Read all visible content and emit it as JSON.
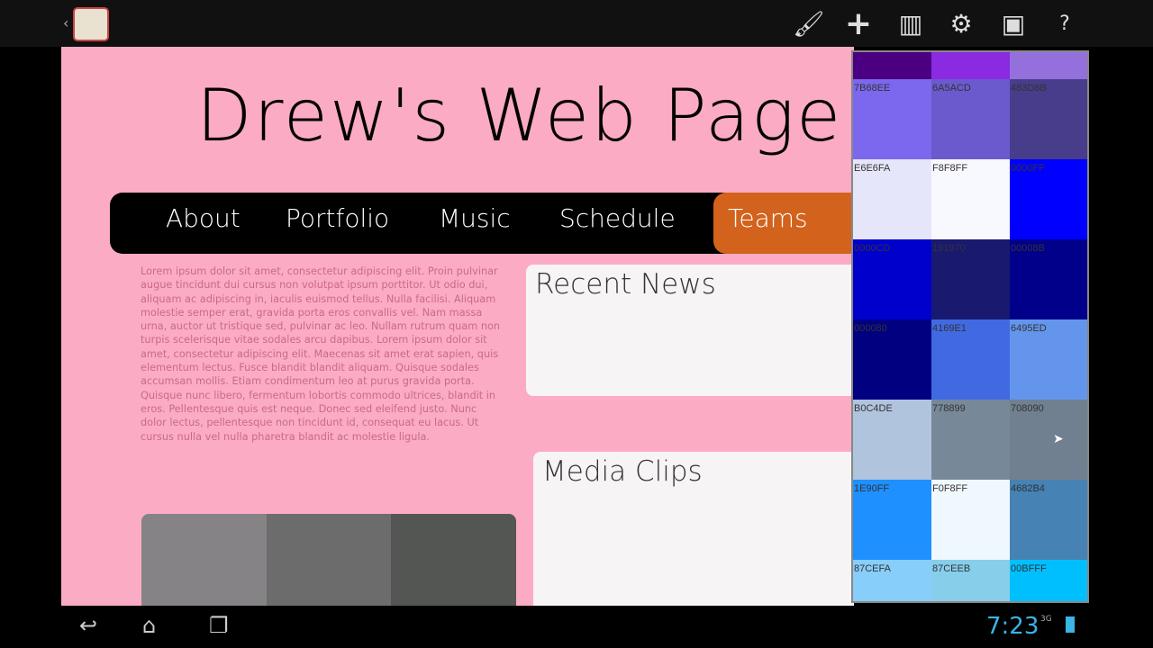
{
  "toolbar": {
    "icons": [
      "brush-icon",
      "plus-icon",
      "paint-roller-icon",
      "gear-icon",
      "browser-preview-icon",
      "help-icon"
    ]
  },
  "page": {
    "title": "Drew's Web Page",
    "nav": [
      "About",
      "Portfolio",
      "Music",
      "Schedule",
      "Teams"
    ],
    "body_text": "Lorem ipsum dolor sit amet, consectetur adipiscing elit. Proin pulvinar augue tincidunt dui cursus non volutpat ipsum porttitor. Ut odio dui, aliquam ac adipiscing in, iaculis euismod tellus. Nulla facilisi. Aliquam molestie semper erat, gravida porta eros convallis vel. Nam massa urna, auctor ut tristique sed, pulvinar ac leo. Nullam rutrum quam non turpis scelerisque vitae sodales arcu dapibus. Lorem ipsum dolor sit amet, consectetur adipiscing elit. Maecenas sit amet erat sapien, quis elementum lectus. Fusce blandit blandit aliquam. Quisque sodales accumsan mollis. Etiam condimentum leo at purus gravida porta. Quisque nunc libero, fermentum lobortis commodo ultrices, blandit in eros. Pellentesque quis est neque. Donec sed eleifend justo. Nunc dolor lectus, pellentesque non tincidunt id, consequat eu lacus. Ut cursus nulla vel nulla pharetra blandit ac molestie ligula.",
    "recent_news": "Recent News",
    "media_clips": "Media Clips",
    "accent": "#d2621c"
  },
  "palette": [
    {
      "hex": "4B0082",
      "label": ""
    },
    {
      "hex": "8A2BE2",
      "label": ""
    },
    {
      "hex": "9370DB",
      "label": ""
    },
    {
      "hex": "7B68EE",
      "label": "7B68EE"
    },
    {
      "hex": "6A5ACD",
      "label": "6A5ACD"
    },
    {
      "hex": "483D8B",
      "label": "483D8B"
    },
    {
      "hex": "E6E6FA",
      "label": "E6E6FA"
    },
    {
      "hex": "F8F8FF",
      "label": "F8F8FF"
    },
    {
      "hex": "0000FF",
      "label": "0000FF"
    },
    {
      "hex": "0000CD",
      "label": "0000CD"
    },
    {
      "hex": "191970",
      "label": "191970"
    },
    {
      "hex": "00008B",
      "label": "00008B"
    },
    {
      "hex": "000080",
      "label": "000080"
    },
    {
      "hex": "4169E1",
      "label": "4169E1"
    },
    {
      "hex": "6495ED",
      "label": "6495ED"
    },
    {
      "hex": "B0C4DE",
      "label": "B0C4DE"
    },
    {
      "hex": "778899",
      "label": "778899"
    },
    {
      "hex": "708090",
      "label": "708090"
    },
    {
      "hex": "1E90FF",
      "label": "1E90FF"
    },
    {
      "hex": "F0F8FF",
      "label": "F0F8FF"
    },
    {
      "hex": "4682B4",
      "label": "4682B4"
    },
    {
      "hex": "87CEFA",
      "label": "87CEFA"
    },
    {
      "hex": "87CEEB",
      "label": "87CEEB"
    },
    {
      "hex": "00BFFF",
      "label": "00BFFF"
    }
  ],
  "status": {
    "time": "7:23",
    "network": "3G"
  }
}
